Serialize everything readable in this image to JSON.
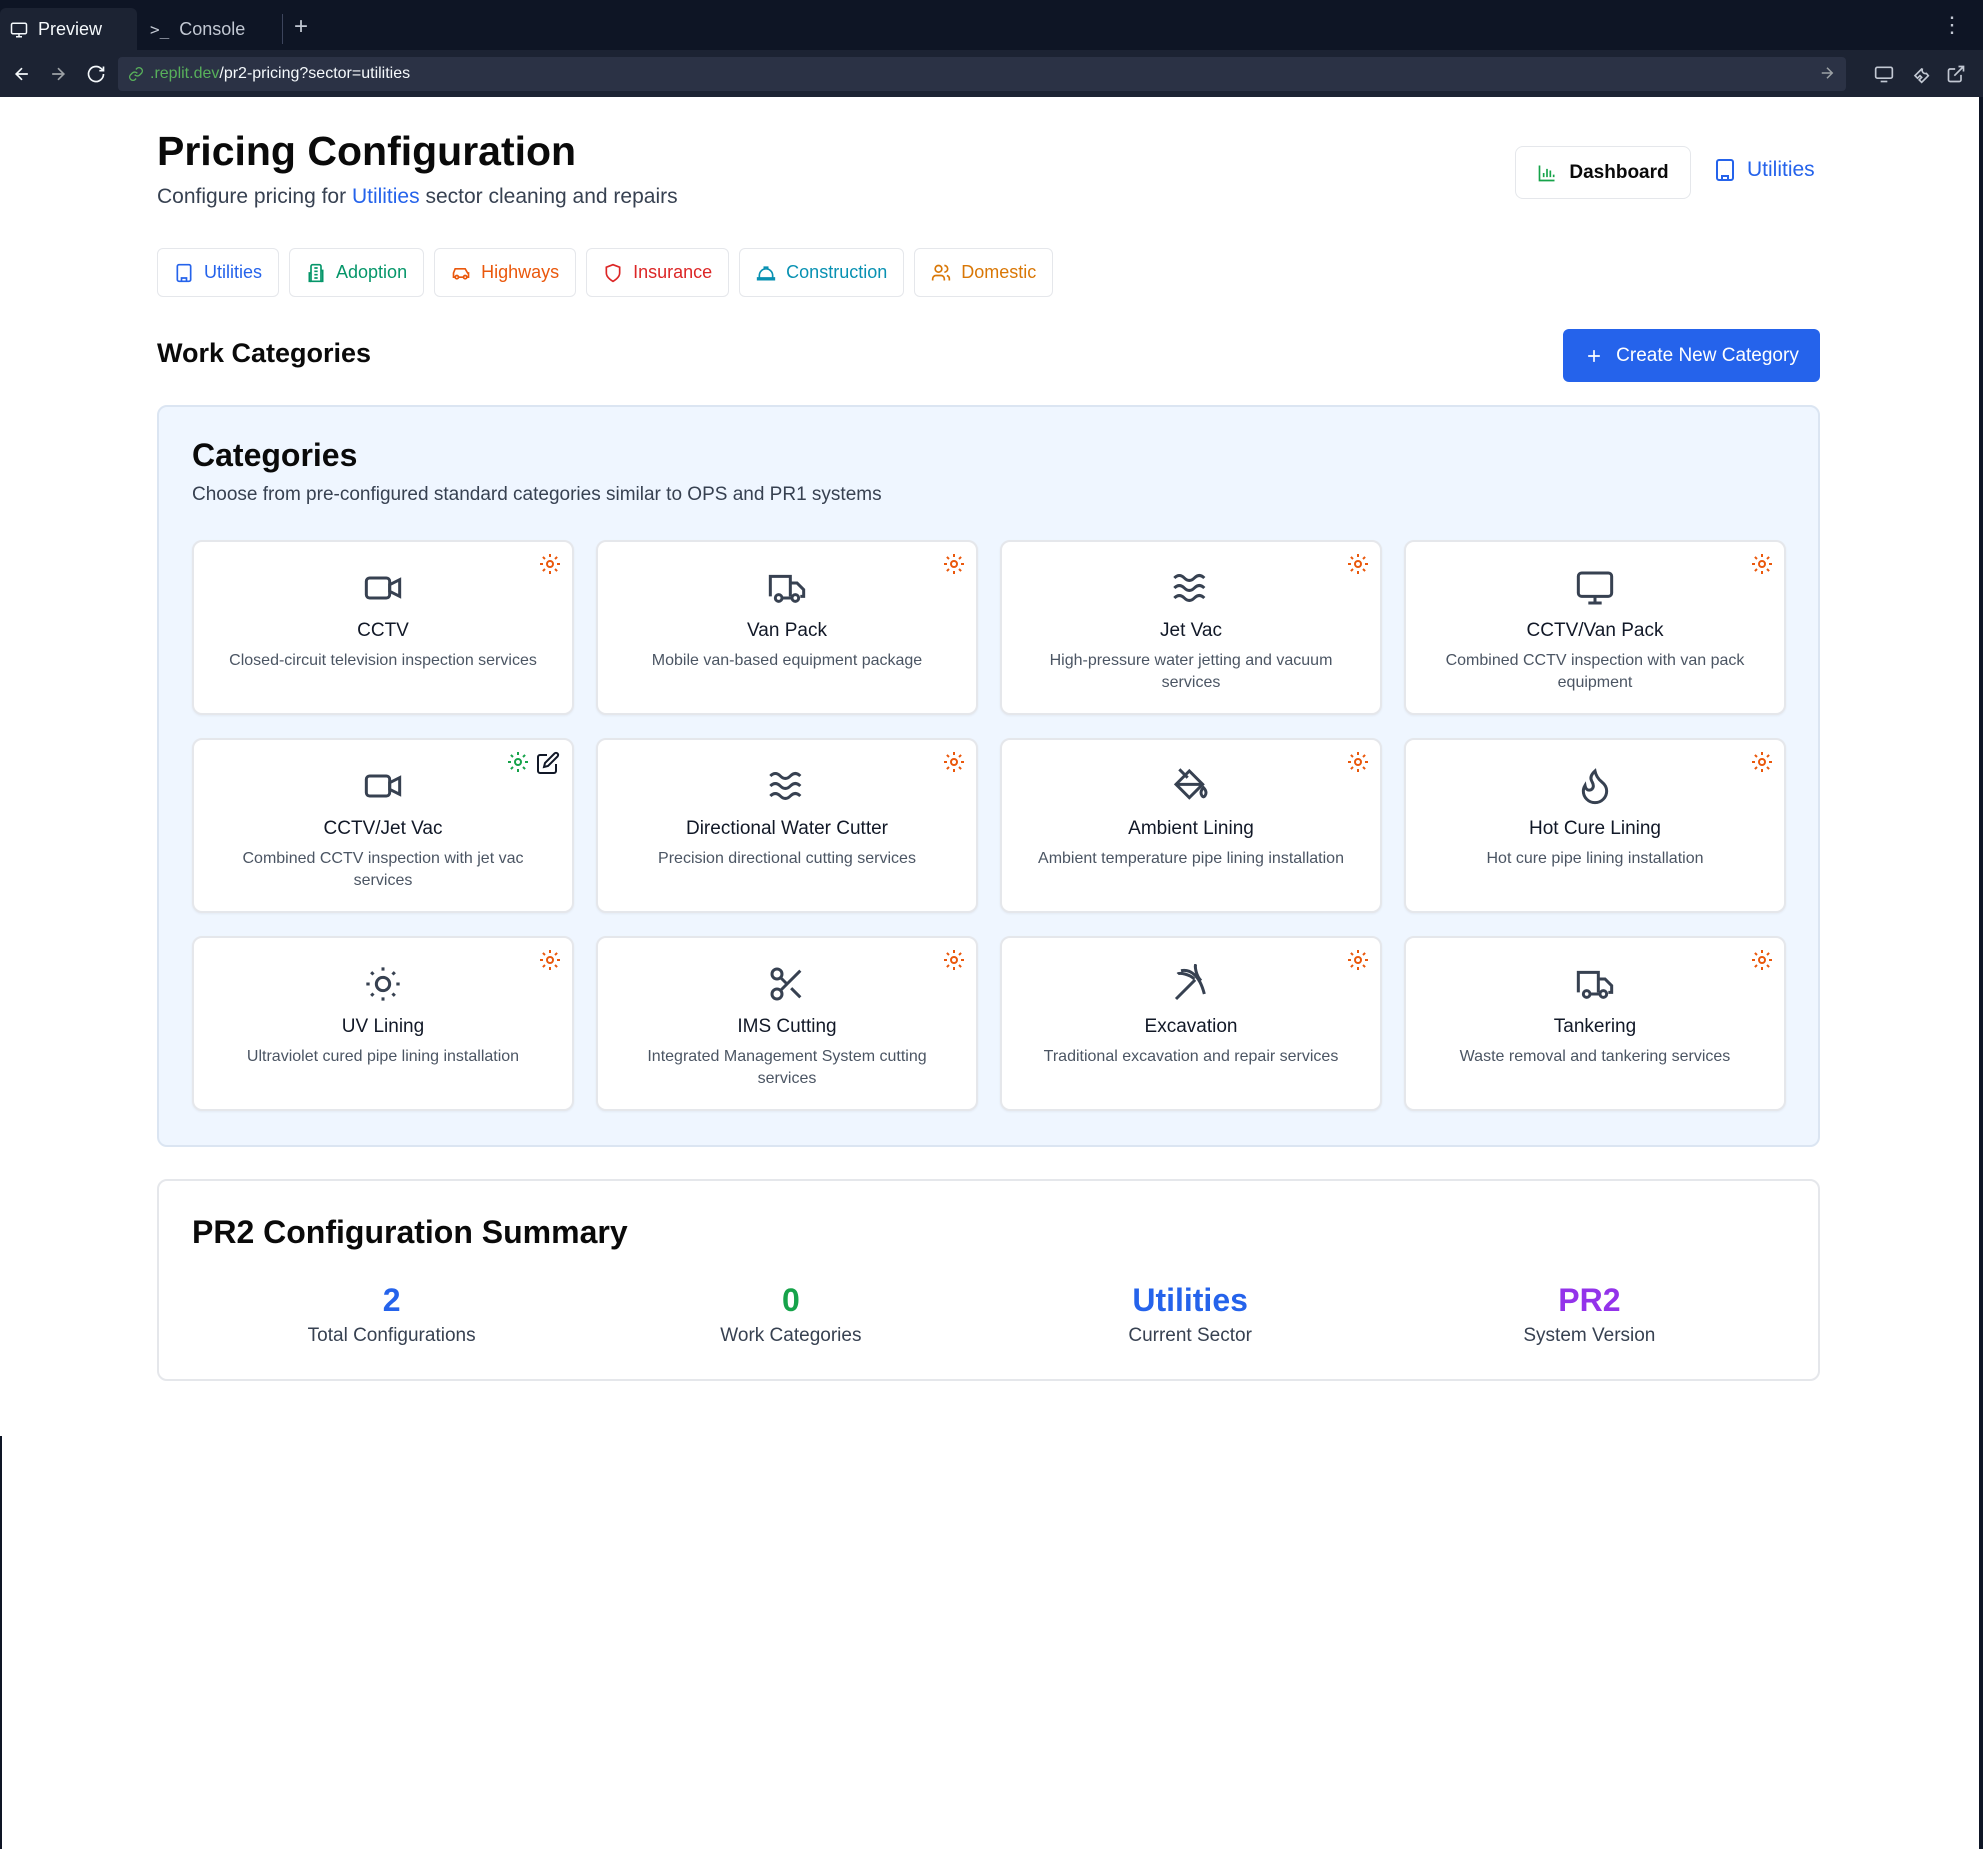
{
  "browser": {
    "tabs": [
      {
        "label": "Preview",
        "icon": "monitor-icon"
      },
      {
        "label": "Console",
        "icon": "terminal-icon"
      }
    ],
    "url_domain": ".replit.dev",
    "url_path": "/pr2-pricing?sector=utilities"
  },
  "header": {
    "title": "Pricing Configuration",
    "subtitle_prefix": "Configure pricing for ",
    "subtitle_sector": "Utilities",
    "subtitle_suffix": " sector cleaning and repairs",
    "dashboard_label": "Dashboard",
    "current_sector": "Utilities"
  },
  "sectors": [
    {
      "label": "Utilities",
      "color": "#2563eb",
      "icon": "building-icon"
    },
    {
      "label": "Adoption",
      "color": "#059669",
      "icon": "office-building-icon"
    },
    {
      "label": "Highways",
      "color": "#ea580c",
      "icon": "car-icon"
    },
    {
      "label": "Insurance",
      "color": "#dc2626",
      "icon": "shield-icon"
    },
    {
      "label": "Construction",
      "color": "#0891b2",
      "icon": "hard-hat-icon"
    },
    {
      "label": "Domestic",
      "color": "#d97706",
      "icon": "users-icon"
    }
  ],
  "work_categories": {
    "title": "Work Categories",
    "create_label": "Create New Category"
  },
  "categories_panel": {
    "title": "Categories",
    "description": "Choose from pre-configured standard categories similar to OPS and PR1 systems",
    "items": [
      {
        "name": "CCTV",
        "desc": "Closed-circuit television inspection services",
        "icon": "video-icon",
        "configured": false
      },
      {
        "name": "Van Pack",
        "desc": "Mobile van-based equipment package",
        "icon": "truck-icon",
        "configured": false
      },
      {
        "name": "Jet Vac",
        "desc": "High-pressure water jetting and vacuum services",
        "icon": "waves-icon",
        "configured": false
      },
      {
        "name": "CCTV/Van Pack",
        "desc": "Combined CCTV inspection with van pack equipment",
        "icon": "monitor-icon",
        "configured": false
      },
      {
        "name": "CCTV/Jet Vac",
        "desc": "Combined CCTV inspection with jet vac services",
        "icon": "video-icon",
        "configured": true
      },
      {
        "name": "Directional Water Cutter",
        "desc": "Precision directional cutting services",
        "icon": "waves-icon",
        "configured": false
      },
      {
        "name": "Ambient Lining",
        "desc": "Ambient temperature pipe lining installation",
        "icon": "paint-bucket-icon",
        "configured": false
      },
      {
        "name": "Hot Cure Lining",
        "desc": "Hot cure pipe lining installation",
        "icon": "flame-icon",
        "configured": false
      },
      {
        "name": "UV Lining",
        "desc": "Ultraviolet cured pipe lining installation",
        "icon": "sun-icon",
        "configured": false
      },
      {
        "name": "IMS Cutting",
        "desc": "Integrated Management System cutting services",
        "icon": "scissors-icon",
        "configured": false
      },
      {
        "name": "Excavation",
        "desc": "Traditional excavation and repair services",
        "icon": "pickaxe-icon",
        "configured": false
      },
      {
        "name": "Tankering",
        "desc": "Waste removal and tankering services",
        "icon": "truck-icon",
        "configured": false
      }
    ]
  },
  "summary": {
    "title": "PR2 Configuration Summary",
    "stats": [
      {
        "value": "2",
        "label": "Total Configurations",
        "color": "#2563eb"
      },
      {
        "value": "0",
        "label": "Work Categories",
        "color": "#16a34a"
      },
      {
        "value": "Utilities",
        "label": "Current Sector",
        "color": "#2563eb"
      },
      {
        "value": "PR2",
        "label": "System Version",
        "color": "#9333ea"
      }
    ]
  },
  "colors": {
    "accent": "#2563eb",
    "gear_default": "#ea580c",
    "gear_configured": "#16a34a"
  }
}
